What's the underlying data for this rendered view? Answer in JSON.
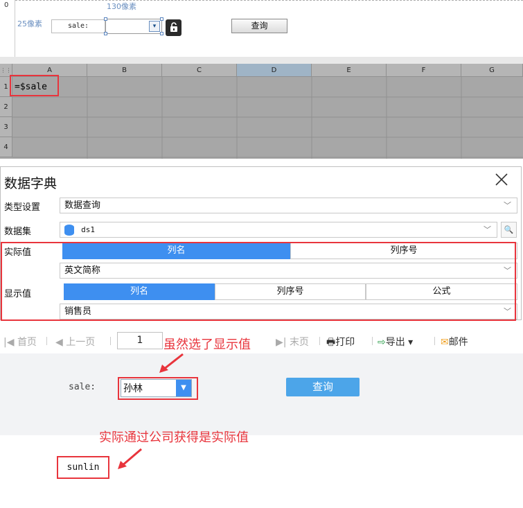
{
  "designer": {
    "ruler_zero": "0",
    "width_guide": "130像素",
    "height_guide": "25像素",
    "param_label": "sale:",
    "query_button": "查询",
    "lock_icon": "unlock-icon",
    "combo_icon": "combo-dropdown-icon"
  },
  "sheet": {
    "columns": [
      "A",
      "B",
      "C",
      "D",
      "E",
      "F",
      "G"
    ],
    "selected_column": "D",
    "rows": [
      "1",
      "2",
      "3",
      "4"
    ],
    "cell_a1": "=$sale"
  },
  "dialog": {
    "title": "数据字典",
    "close_icon": "close-icon",
    "type_label": "类型设置",
    "type_value": "数据查询",
    "dataset_label": "数据集",
    "dataset_value": "ds1",
    "actual_label": "实际值",
    "actual_tabs": [
      "列名",
      "列序号"
    ],
    "actual_active": "列名",
    "actual_column": "英文简称",
    "display_label": "显示值",
    "display_tabs": [
      "列名",
      "列序号",
      "公式"
    ],
    "display_active": "列名",
    "display_column": "销售员",
    "accent_color": "#3e8ff0"
  },
  "preview": {
    "toolbar": {
      "first": "首页",
      "prev": "上一页",
      "page": "1",
      "last": "末页",
      "print": "打印",
      "export": "导出",
      "email": "邮件"
    },
    "param_label": "sale:",
    "combo_value": "孙林",
    "query_button": "查询",
    "annotation_display": "虽然选了显示值"
  },
  "result": {
    "annotation_actual": "实际通过公司获得是实际值",
    "value": "sunlin"
  },
  "annotation_color": "#e8343c"
}
